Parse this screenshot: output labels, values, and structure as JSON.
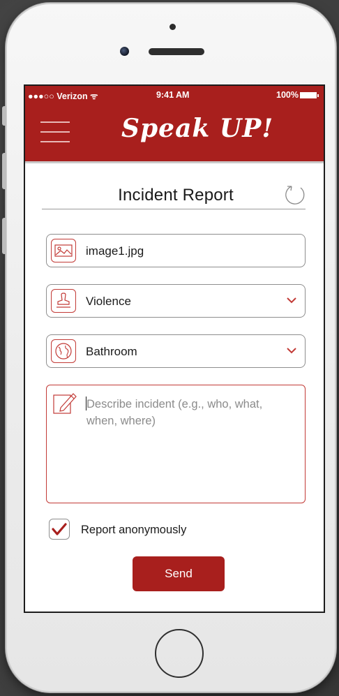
{
  "status_bar": {
    "carrier": "●●●○○ Verizon ᯤ",
    "time": "9:41 AM",
    "battery": "100%"
  },
  "app": {
    "title": "Speak UP!",
    "brand_color": "#a81f1d"
  },
  "form": {
    "heading": "Incident Report",
    "image_field": {
      "value": "image1.jpg",
      "icon": "image-icon"
    },
    "category_field": {
      "value": "Violence",
      "icon": "stamp-icon"
    },
    "location_field": {
      "value": "Bathroom",
      "icon": "globe-icon"
    },
    "description_field": {
      "placeholder": "Describe incident (e.g., who, what, when, where)",
      "icon": "pencil-icon"
    },
    "anonymous_checkbox": {
      "label": "Report anonymously",
      "checked": true
    },
    "send_label": "Send"
  }
}
